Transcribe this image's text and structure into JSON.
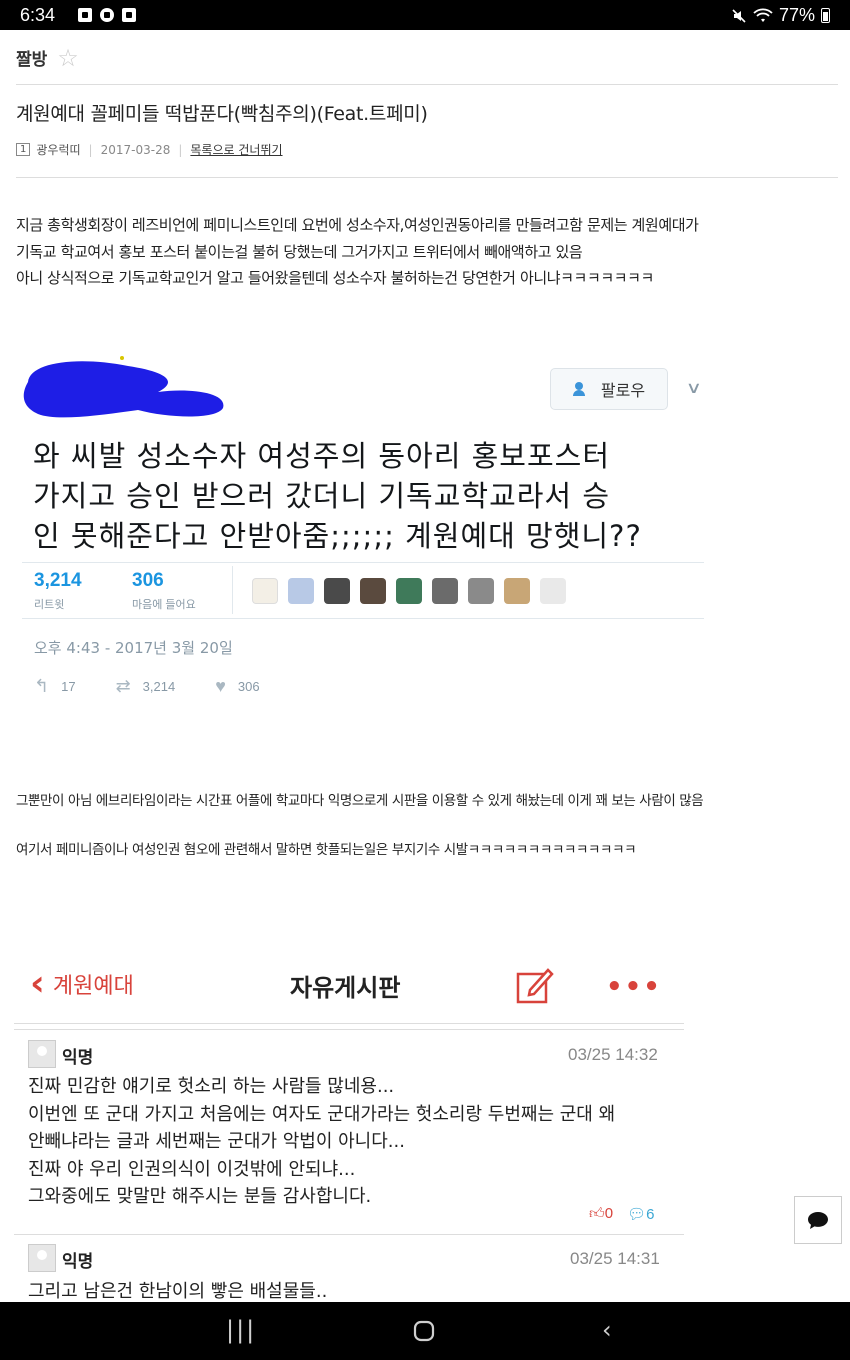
{
  "status_bar": {
    "time": "6:34",
    "battery": "77%"
  },
  "header": {
    "board_name": "짤방",
    "star": "☆"
  },
  "post": {
    "title": "계원예대 꼴페미들 떡밥푼다(빡침주의)(Feat.트페미)",
    "rank": "1",
    "author": "광우럭띠",
    "date": "2017-03-28",
    "skip_link": "목록으로 건너뛰기",
    "body_lines": [
      "지금 총학생회장이 레즈비언에 페미니스트인데 요번에 성소수자,여성인권동아리를 만들려고함 문제는 계원예대가",
      "기독교 학교여서 홍보 포스터 붙이는걸 불허 당했는데 그거가지고 트위터에서 빼애액하고 있음",
      "아니 상식적으로 기독교학교인거 알고 들어왔을텐데 성소수자 불허하는건 당연한거 아니냐ㅋㅋㅋㅋㅋㅋㅋ"
    ],
    "para2": "그뿐만이 아님 에브리타임이라는 시간표 어플에 학교마다 익명으로게 시판을 이용할 수 있게 해놨는데 이게 꽤 보는 사람이 많음",
    "para3": "여기서 페미니즘이나 여성인권 혐오에 관련해서 말하면 핫플되는일은 부지기수 시발ㅋㅋㅋㅋㅋㅋㅋㅋㅋㅋㅋㅋㅋㅋ"
  },
  "tweet": {
    "follow_label": "팔로우",
    "text_lines": [
      "와 씨발 성소수자 여성주의 동아리 홍보포스터",
      "가지고 승인 받으러 갔더니 기독교학교라서 승",
      "인 못해준다고 안받아줌;;;;;; 계원예대 망햇니??"
    ],
    "retweets": "3,214",
    "retweets_label": "리트윗",
    "likes": "306",
    "likes_label": "마음에 들어요",
    "timestamp": "오후 4:43 - 2017년 3월 20일",
    "reply_count": "17",
    "retweet_count": "3,214",
    "like_count": "306",
    "colors": {
      "accent": "#1b95e0",
      "muted": "#8899a6"
    }
  },
  "everytime": {
    "back_label": "계원예대",
    "title": "자유게시판",
    "more": "•••",
    "accent": "#d8433b",
    "posts": [
      {
        "name": "익명",
        "time": "03/25 14:32",
        "lines": [
          "진짜 민감한 얘기로 헛소리 하는 사람들 많네용...",
          "이번엔 또 군대 가지고 처음에는 여자도 군대가라는 헛소리랑 두번째는 군대 왜",
          "안빼냐라는 글과 세번째는 군대가 악법이 아니다...",
          "진짜 야 우리 인권의식이 이것밖에 안되냐...",
          "그와중에도 맞말만 해주시는 분들 감사합니다."
        ],
        "likes": "0",
        "comments": "6"
      },
      {
        "name": "익명",
        "time": "03/25 14:31",
        "lines": [
          "그리고 남은건 한남이의 빻은 배설물들.."
        ]
      }
    ]
  }
}
